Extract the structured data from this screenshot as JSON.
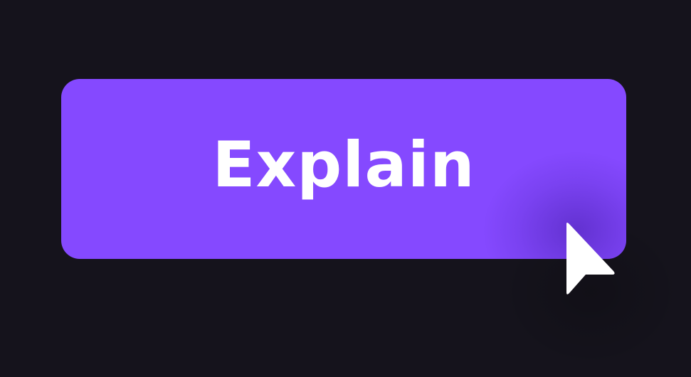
{
  "button": {
    "label": "Explain"
  },
  "colors": {
    "background": "#15131c",
    "button_fill": "#8549ff",
    "label": "#ffffff",
    "cursor": "#ffffff"
  },
  "icons": {
    "cursor": "mouse-pointer-arrow-icon"
  }
}
